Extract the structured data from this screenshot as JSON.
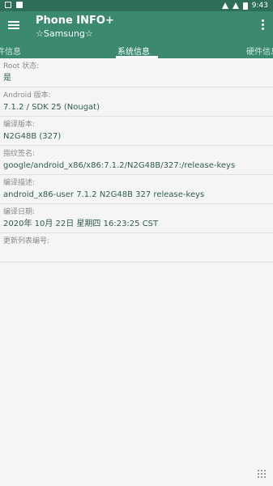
{
  "status_bar": {
    "time": "9:43",
    "left_icons": [
      "notification-square-icon",
      "notification-a-icon"
    ],
    "right_icons": [
      "wifi-icon",
      "signal-icon",
      "battery-icon"
    ]
  },
  "app_bar": {
    "title": "Phone INFO+",
    "subtitle": "☆Samsung☆",
    "background": "#3b8a6e",
    "status_background": "#2f6f5a"
  },
  "tabs": [
    {
      "label": "组件信息",
      "visible_label": "件信息",
      "selected": false
    },
    {
      "label": "系统信息",
      "selected": true
    },
    {
      "label": "硬件信息",
      "visible_label": "硬件信息",
      "selected": false
    }
  ],
  "items": [
    {
      "label": "Root 状态:",
      "value": "是"
    },
    {
      "label": "Android 版本:",
      "value": "7.1.2 / SDK 25 (Nougat)"
    },
    {
      "label": "编译版本:",
      "value": "N2G48B (327)"
    },
    {
      "label": "指纹签名:",
      "value": "google/android_x86/x86:7.1.2/N2G48B/327:/release-keys"
    },
    {
      "label": "编译描述:",
      "value": "android_x86-user 7.1.2 N2G48B 327 release-keys"
    },
    {
      "label": "编译日期:",
      "value": "2020年 10月 22日 星期四 16:23:25 CST"
    },
    {
      "label": "更新列表编号:",
      "value": ""
    }
  ],
  "value_color": "#2f5e4d"
}
